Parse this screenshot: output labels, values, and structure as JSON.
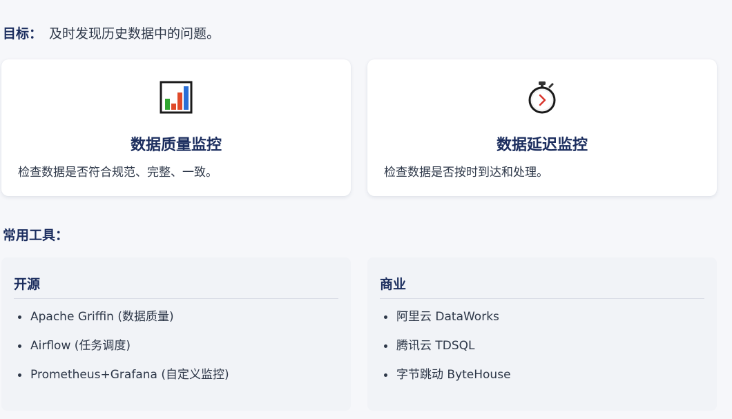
{
  "goal": {
    "label": "目标：",
    "text": "及时发现历史数据中的问题。"
  },
  "cards": [
    {
      "icon": "bar-chart-icon",
      "title": "数据质量监控",
      "description": "检查数据是否符合规范、完整、一致。"
    },
    {
      "icon": "stopwatch-icon",
      "title": "数据延迟监控",
      "description": "检查数据是否按时到达和处理。"
    }
  ],
  "tools": {
    "title": "常用工具：",
    "open_source": {
      "heading": "开源",
      "items": [
        "Apache Griffin (数据质量)",
        "Airflow (任务调度)",
        "Prometheus+Grafana (自定义监控)"
      ]
    },
    "commercial": {
      "heading": "商业",
      "items": [
        "阿里云 DataWorks",
        "腾讯云 TDSQL",
        "字节跳动 ByteHouse"
      ]
    }
  },
  "colors": {
    "heading": "#1b2d5e",
    "text": "#2d3748",
    "background": "#f6f7fa",
    "card": "#ffffff",
    "panel": "#f1f3f7"
  }
}
